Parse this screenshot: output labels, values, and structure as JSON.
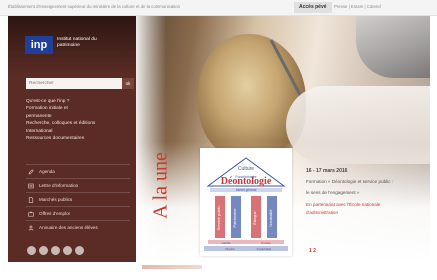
{
  "topbar": {
    "tagline": "Établissement d'enseignement supérieur du ministère de la culture et de la communication",
    "accueil_label": "Accès pévé",
    "links": "Presse | Erasm | Catend"
  },
  "logo": {
    "acronym": "inp",
    "name": "Institut national du patrimoine"
  },
  "search": {
    "placeholder": "Rechercher",
    "button_label": "ok"
  },
  "nav": {
    "items": [
      "Qu'est-ce que l'inp ?",
      "Formation initiale et",
      "permanente",
      "Recherche, colloques et éditions",
      "International",
      "Ressources documentaires"
    ]
  },
  "quick_links": [
    {
      "label": "Agenda",
      "icon": "pencil-icon"
    },
    {
      "label": "Lettre d'information",
      "icon": "newsletter-icon"
    },
    {
      "label": "Marchés publics",
      "icon": "document-icon"
    },
    {
      "label": "Offres d'emploi",
      "icon": "briefcase-icon"
    },
    {
      "label": "Annuaire des anciens élèves",
      "icon": "users-icon"
    }
  ],
  "social": [
    "facebook-icon",
    "twitter-icon",
    "youtube-icon",
    "linkedin-icon",
    "rss-icon"
  ],
  "ala": "A la une",
  "cloud": {
    "words": [
      "Culture",
      "Déontologie",
      "Fonctionnaire",
      "Intérêt général",
      "Service public",
      "Patrimoine",
      "Éthique",
      "Neutralité",
      "Laïcité",
      "Probité",
      "Dignité",
      "Impartialité"
    ]
  },
  "event": {
    "date": "16 - 17 mars 2016",
    "title_lines": [
      "Formation « Déontologie et service public :",
      "le sens de l'engagement »"
    ],
    "subtitle_lines": [
      "En partenariat avec l'École nationale",
      "d'administration"
    ]
  },
  "pager": "1 2",
  "colors": {
    "sidebar": "#5b2c25",
    "logo_blue": "#1f3f99",
    "accent_red": "#c83a2c",
    "cloud_blue": "#3a55a8",
    "cloud_red": "#c6363d"
  }
}
